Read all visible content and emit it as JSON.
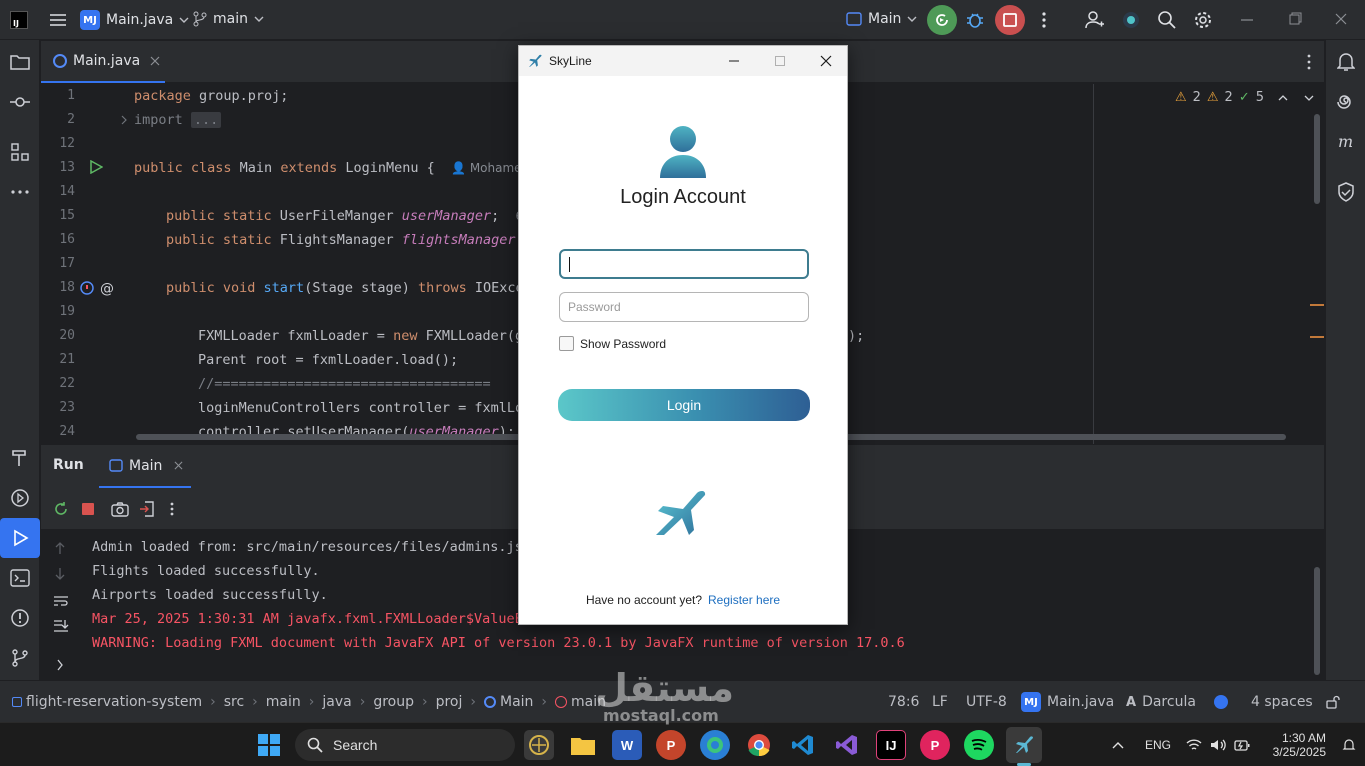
{
  "titlebar": {
    "project_badge": "MJ",
    "project_name": "Main.java",
    "branch": "main",
    "run_config": "Main"
  },
  "editor": {
    "tab_label": "Main.java",
    "inspections": {
      "warnings_a": "2",
      "warnings_b": "2",
      "ok": "5"
    },
    "lines": [
      {
        "num": "1"
      },
      {
        "num": "2"
      },
      {
        "num": "12"
      },
      {
        "num": "13"
      },
      {
        "num": "14"
      },
      {
        "num": "15"
      },
      {
        "num": "16"
      },
      {
        "num": "17"
      },
      {
        "num": "18"
      },
      {
        "num": "19"
      },
      {
        "num": "20"
      },
      {
        "num": "21"
      },
      {
        "num": "22"
      },
      {
        "num": "23"
      },
      {
        "num": "24"
      }
    ],
    "code": {
      "l1_kw": "package",
      "l1_rest": " group.proj;",
      "l2_kw": "import",
      "l2_fold": "...",
      "l13_kw": "public class",
      "l13_name": " Main ",
      "l13_kw2": "extends",
      "l13_rest": " LoginMenu {",
      "l13_author": "Mohamed",
      "l15_kw": "public static",
      "l15_type": " UserFileManger ",
      "l15_field": "userManager",
      "l15_end": ";",
      "l15_hint": "6",
      "l16_kw": "public static",
      "l16_type": " FlightsManager ",
      "l16_field": "flightsManager",
      "l16_end": ";",
      "l18_kw": "public void",
      "l18_fn": " start",
      "l18_mid": "(Stage stage) ",
      "l18_kw2": "throws",
      "l18_rest": " IOExce",
      "l20_a": "FXMLLoader fxmlLoader = ",
      "l20_kw": "new",
      "l20_b": " FXMLLoader(g",
      "l20_tail": ");",
      "l21": "Parent root = fxmlLoader.load();",
      "l22": "//==================================",
      "l23": "loginMenuControllers controller = fxmlLo",
      "l24_a": "controller.setUserManager(",
      "l24_field": "userManager",
      "l24_b": ");"
    }
  },
  "run": {
    "title": "Run",
    "tab_label": "Main",
    "console": [
      {
        "text": "Admin loaded from: src/main/resources/files/admins.js",
        "kind": "ok"
      },
      {
        "text": "Flights loaded successfully.",
        "kind": "ok"
      },
      {
        "text": "Airports loaded successfully.",
        "kind": "ok"
      },
      {
        "text": "Mar 25, 2025 1:30:31 AM javafx.fxml.FXMLLoader$ValueE",
        "kind": "err"
      },
      {
        "text": "WARNING: Loading FXML document with JavaFX API of version 23.0.1 by JavaFX runtime of version 17.0.6",
        "kind": "err"
      }
    ]
  },
  "statusbar": {
    "breadcrumbs": [
      "flight-reservation-system",
      "src",
      "main",
      "java",
      "group",
      "proj",
      "Main",
      "main"
    ],
    "position": "78:6",
    "line_sep": "LF",
    "encoding": "UTF-8",
    "file_badge": "MJ",
    "file": "Main.java",
    "theme": "Darcula",
    "indent": "4 spaces"
  },
  "dialog": {
    "title": "SkyLine",
    "heading": "Login Account",
    "username_value": "",
    "password_placeholder": "Password",
    "show_password_label": "Show Password",
    "login_label": "Login",
    "no_account_text": "Have no account yet?",
    "register_link": "Register here",
    "accent_color": "#3a8fb0"
  },
  "taskbar": {
    "search_label": "Search",
    "language": "ENG",
    "time": "1:30 AM",
    "date": "3/25/2025"
  },
  "watermark": {
    "arabic": "مستقل",
    "latin": "mostaql.com"
  }
}
